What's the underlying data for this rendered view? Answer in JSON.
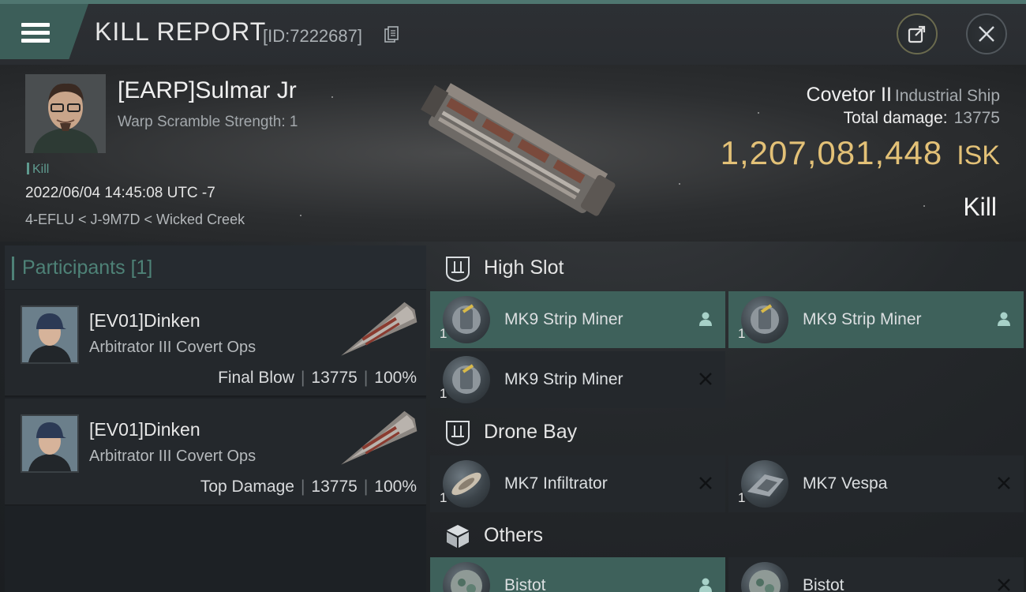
{
  "header": {
    "title": "KILL REPORT",
    "report_id": "[ID:7222687]",
    "accent_color": "#4f7670"
  },
  "victim": {
    "name": "[EARP]Sulmar Jr",
    "warp_scramble": "Warp Scramble Strength: 1",
    "kill_tag": "Kill",
    "datetime": "2022/06/04 14:45:08 UTC -7",
    "location": "4-EFLU < J-9M7D < Wicked Creek",
    "ship_name": "Covetor II",
    "ship_class": "Industrial Ship",
    "total_damage_label": "Total damage:",
    "total_damage": "13775",
    "isk_value": "1,207,081,448",
    "isk_unit": "ISK",
    "isk_color": "#e3c177",
    "result": "Kill"
  },
  "participants": {
    "title": "Participants",
    "count": "[1]",
    "rows": [
      {
        "name": "[EV01]Dinken",
        "ship": "Arbitrator III Covert Ops",
        "role": "Final Blow",
        "damage": "13775",
        "percent": "100%"
      },
      {
        "name": "[EV01]Dinken",
        "ship": "Arbitrator III Covert Ops",
        "role": "Top Damage",
        "damage": "13775",
        "percent": "100%"
      }
    ]
  },
  "fitting": {
    "high_slot": {
      "title": "High Slot",
      "items": [
        {
          "name": "MK9 Strip Miner",
          "qty": "1",
          "status": "person-icon",
          "active": true
        },
        {
          "name": "MK9 Strip Miner",
          "qty": "1",
          "status": "person-icon",
          "active": true
        },
        {
          "name": "MK9 Strip Miner",
          "qty": "1",
          "status": "cross-icon",
          "active": false
        }
      ]
    },
    "drone_bay": {
      "title": "Drone Bay",
      "items": [
        {
          "name": "MK7  Infiltrator",
          "qty": "1",
          "status": "cross-icon",
          "active": false
        },
        {
          "name": "MK7  Vespa",
          "qty": "1",
          "status": "cross-icon",
          "active": false
        }
      ]
    },
    "others": {
      "title": "Others",
      "items": [
        {
          "name": "Bistot",
          "qty": "",
          "status": "person-icon",
          "active": true
        },
        {
          "name": "Bistot",
          "qty": "",
          "status": "cross-icon",
          "active": false
        }
      ]
    }
  }
}
